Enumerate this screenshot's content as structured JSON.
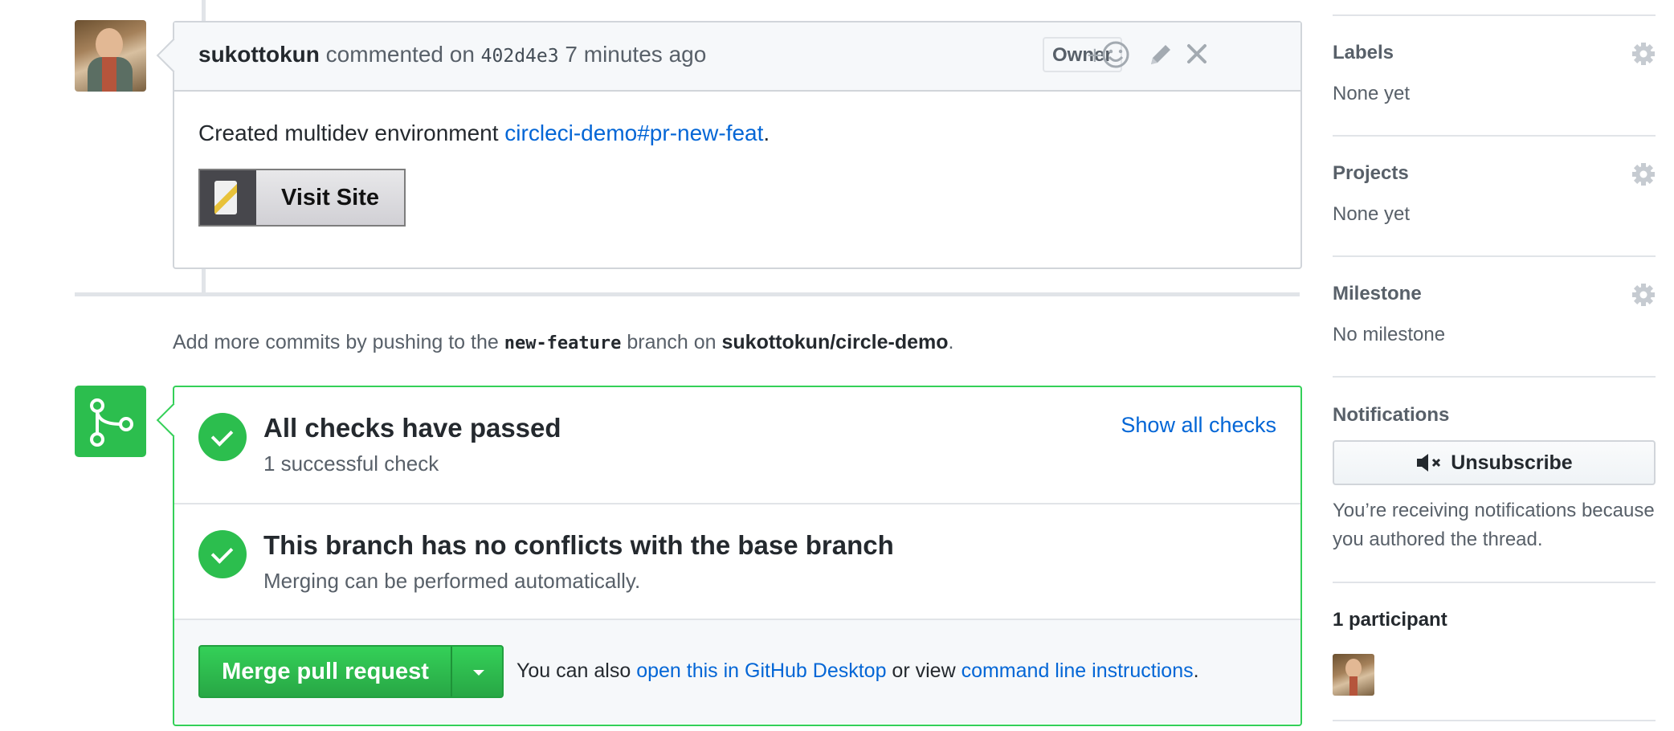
{
  "comment": {
    "author": "sukottokun",
    "action": "commented on",
    "commit": "402d4e3",
    "time": "7 minutes ago",
    "badge": "Owner",
    "reaction_plus": "+",
    "body_prefix": "Created multidev environment ",
    "body_link": "circleci-demo#pr-new-feat",
    "body_suffix": ".",
    "visit_button": "Visit Site"
  },
  "push_note": {
    "prefix": "Add more commits by pushing to the ",
    "branch": "new-feature",
    "middle": " branch on ",
    "repo": "sukottokun/circle-demo",
    "suffix": "."
  },
  "merge": {
    "checks_title": "All checks have passed",
    "checks_sub": "1 successful check",
    "show_all": "Show all checks",
    "conflicts_title": "This branch has no conflicts with the base branch",
    "conflicts_sub": "Merging can be performed automatically.",
    "merge_button": "Merge pull request",
    "footer_prefix": "You can also ",
    "footer_link1": "open this in GitHub Desktop",
    "footer_middle": " or view ",
    "footer_link2": "command line instructions",
    "footer_suffix": "."
  },
  "sidebar": {
    "labels": {
      "title": "Labels",
      "value": "None yet"
    },
    "projects": {
      "title": "Projects",
      "value": "None yet"
    },
    "milestone": {
      "title": "Milestone",
      "value": "No milestone"
    },
    "notifications": {
      "title": "Notifications",
      "button": "Unsubscribe",
      "note": "You’re receiving notifications because you authored the thread."
    },
    "participants": {
      "title": "1 participant"
    }
  },
  "colors": {
    "green": "#2cbe4e",
    "link": "#0366d6"
  }
}
